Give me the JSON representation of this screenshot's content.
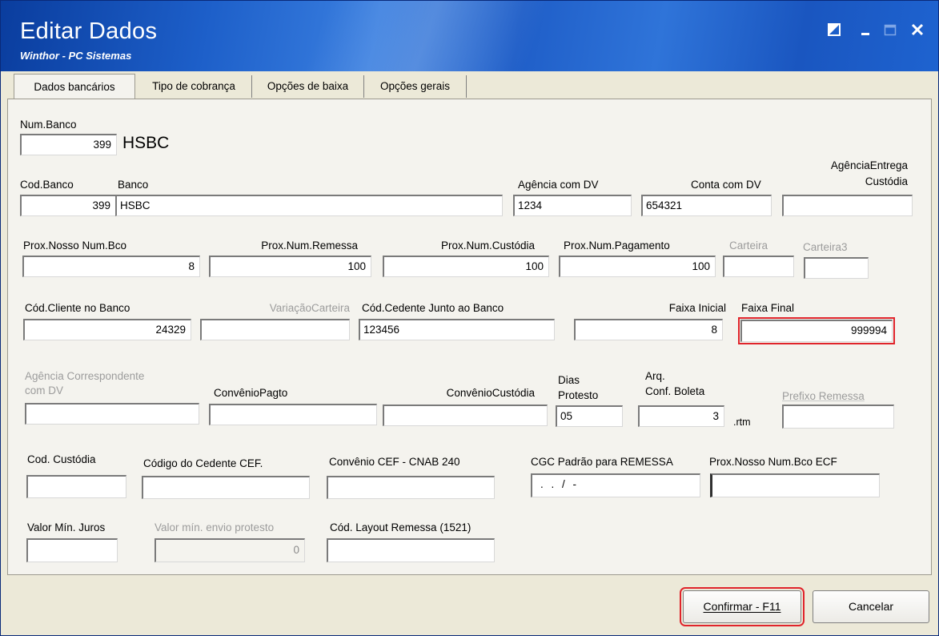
{
  "window": {
    "title": "Editar Dados",
    "subtitle": "Winthor - PC Sistemas"
  },
  "tabs": [
    {
      "label": "Dados bancários",
      "active": true
    },
    {
      "label": "Tipo de cobrança"
    },
    {
      "label": "Opções de baixa"
    },
    {
      "label": "Opções gerais"
    }
  ],
  "form": {
    "num_banco": {
      "label": "Num.Banco",
      "value": "399",
      "bank_name": "HSBC"
    },
    "cod_banco": {
      "label": "Cod.Banco",
      "value": "399"
    },
    "banco": {
      "label": "Banco",
      "value": "HSBC"
    },
    "agencia_dv": {
      "label": "Agência com DV",
      "value": "1234"
    },
    "conta_dv": {
      "label": "Conta com DV",
      "value": "654321"
    },
    "agencia_entrega_1": "AgênciaEntrega",
    "agencia_entrega_2": "Custódia",
    "agencia_entrega_value": "",
    "prox_nosso_num": {
      "label": "Prox.Nosso Num.Bco",
      "value": "8"
    },
    "prox_num_remessa": {
      "label": "Prox.Num.Remessa",
      "value": "100"
    },
    "prox_num_custodia": {
      "label": "Prox.Num.Custódia",
      "value": "100"
    },
    "prox_num_pagamento": {
      "label": "Prox.Num.Pagamento",
      "value": "100"
    },
    "carteira": {
      "label": "Carteira",
      "value": ""
    },
    "carteira3": {
      "label": "Carteira3",
      "value": ""
    },
    "cod_cliente": {
      "label": "Cód.Cliente no Banco",
      "value": "24329"
    },
    "variacao_carteira": {
      "label": "VariaçãoCarteira",
      "value": ""
    },
    "cod_cedente": {
      "label": "Cód.Cedente Junto ao Banco",
      "value": "123456"
    },
    "faixa_inicial": {
      "label": "Faixa Inicial",
      "value": "8"
    },
    "faixa_final": {
      "label": "Faixa Final",
      "value": "999994"
    },
    "agencia_corresp_1": "Agência Correspondente",
    "agencia_corresp_2": "com DV",
    "agencia_corresp_value": "",
    "convenio_pagto": {
      "label": "ConvênioPagto",
      "value": ""
    },
    "convenio_custodia": {
      "label": "ConvênioCustódia",
      "value": ""
    },
    "dias_protesto_1": "Dias",
    "dias_protesto_2": "Protesto",
    "dias_protesto_value": "05",
    "arq_conf_1": "Arq.",
    "arq_conf_2": "Conf. Boleta",
    "arq_conf_value": "3",
    "arq_conf_ext": ".rtm",
    "prefixo_remessa": {
      "label": "Prefixo Remessa",
      "value": ""
    },
    "cod_custodia": {
      "label": "Cod. Custódia",
      "value": ""
    },
    "codigo_cedente_cef": {
      "label": "Código do Cedente CEF.",
      "value": ""
    },
    "convenio_cef": {
      "label": "Convênio CEF - CNAB 240",
      "value": ""
    },
    "cgc_padrao": {
      "label": "CGC Padrão para REMESSA",
      "value": " .  .  /   -"
    },
    "prox_nosso_num_ecf": {
      "label": "Prox.Nosso Num.Bco ECF",
      "value": ""
    },
    "valor_min_juros": {
      "label": "Valor Mín. Juros",
      "value": ""
    },
    "valor_min_protesto": {
      "label": "Valor mín. envio protesto",
      "value": "0"
    },
    "cod_layout_remessa": {
      "label": "Cód. Layout Remessa (1521)",
      "value": ""
    }
  },
  "buttons": {
    "confirm": "Confirmar - F11",
    "cancel": "Cancelar"
  },
  "colors": {
    "titlebar": "#1d5fc9",
    "highlight": "#e0242b"
  }
}
